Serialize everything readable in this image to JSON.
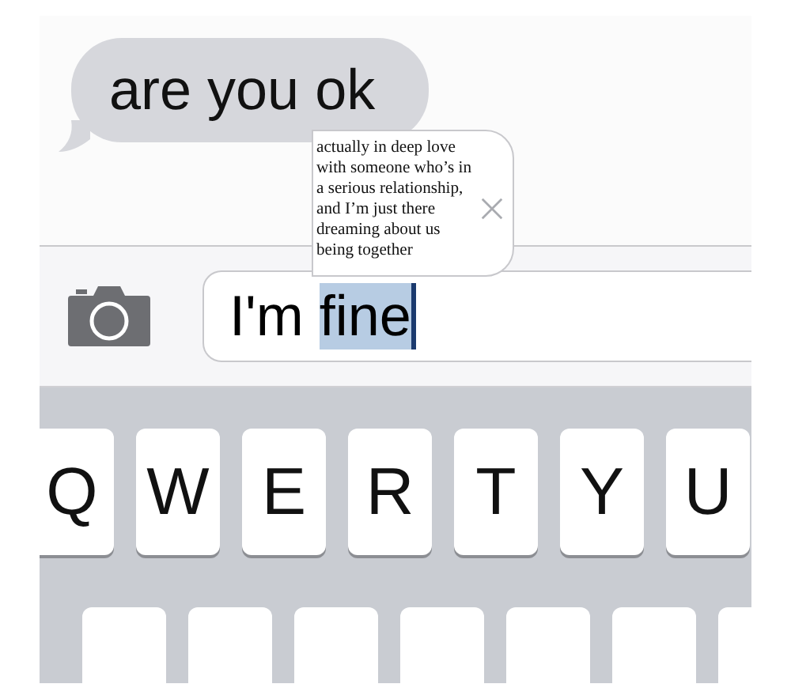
{
  "messages": [
    {
      "text": "are you ok"
    }
  ],
  "autocorrect": {
    "text": "actually in deep love with someone who’s in a serious relationship, and I’m just there dreaming about us being together"
  },
  "input": {
    "parts": [
      {
        "text": "I'm ",
        "selected": false
      },
      {
        "text": "fine",
        "selected": true
      }
    ]
  },
  "keyboard": {
    "rows": [
      [
        "Q",
        "W",
        "E",
        "R",
        "T",
        "Y",
        "U"
      ]
    ]
  }
}
